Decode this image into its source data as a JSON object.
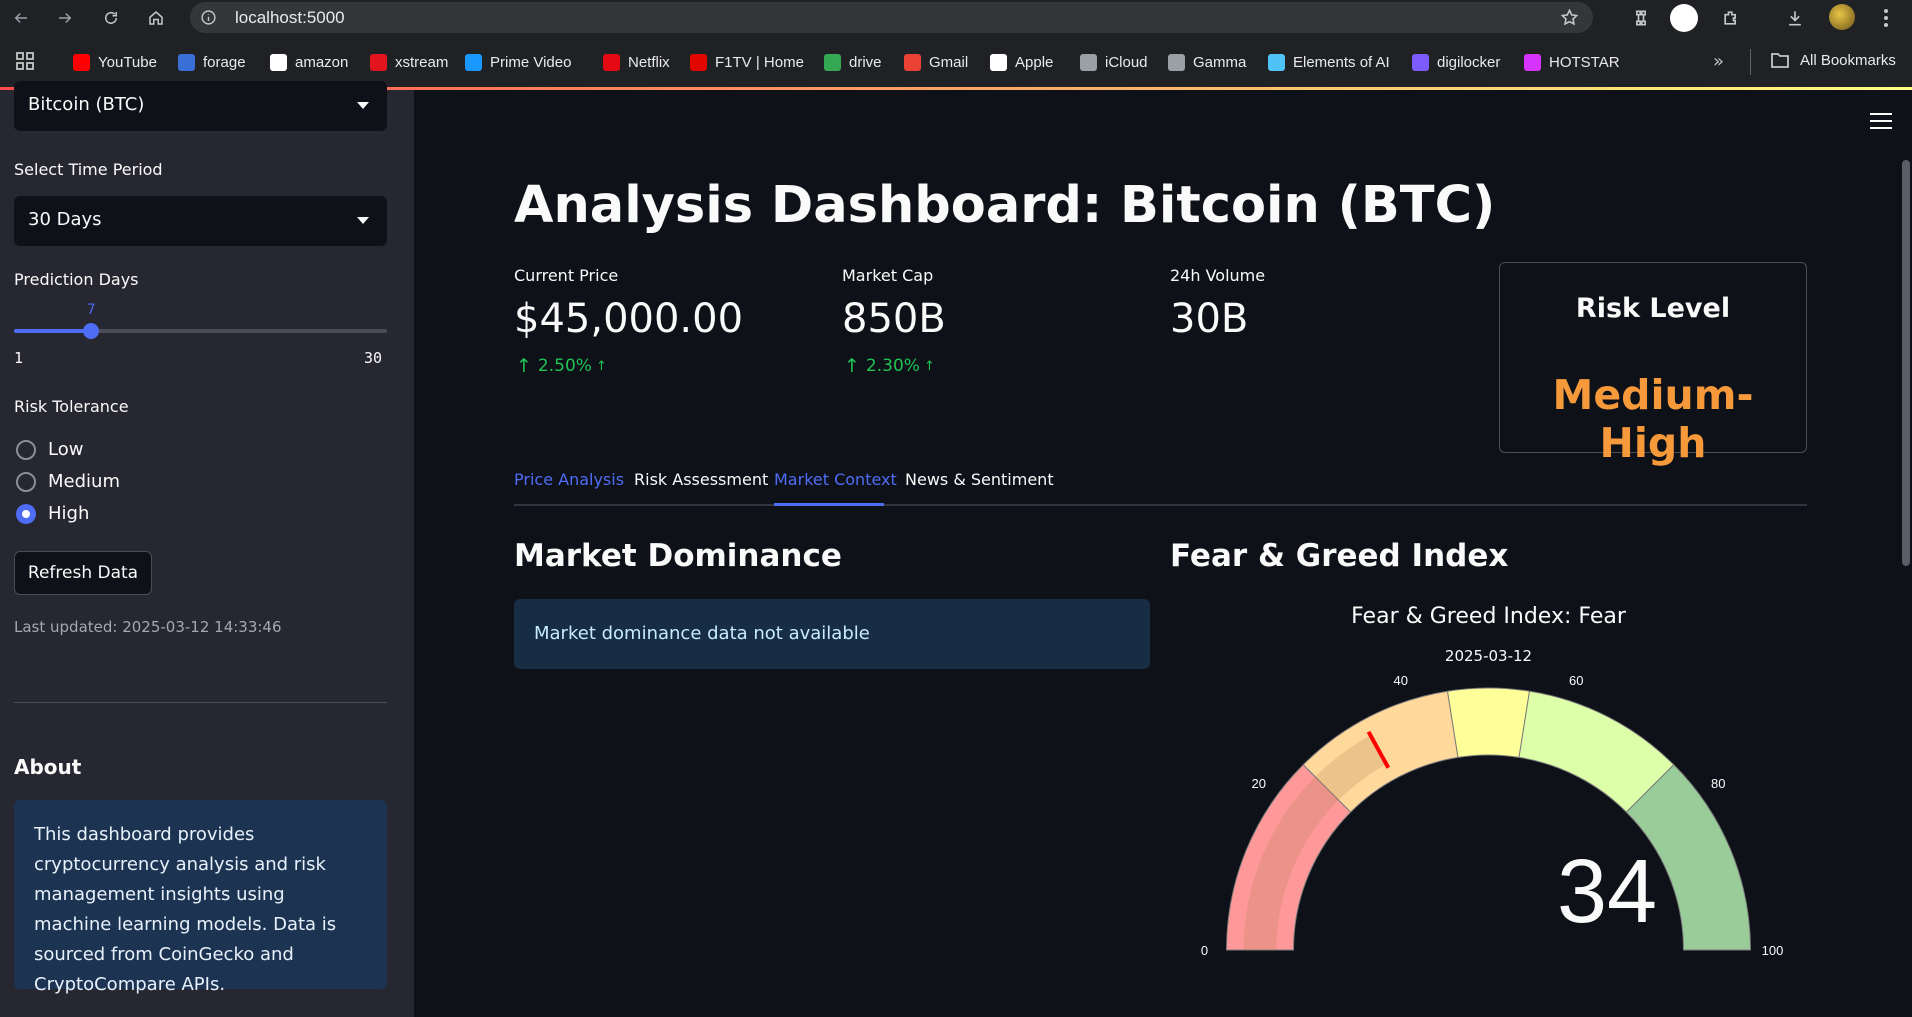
{
  "browser": {
    "url": "localhost:5000",
    "bookmarks": [
      {
        "label": "YouTube",
        "color": "#ff0000"
      },
      {
        "label": "forage",
        "color": "#3a6fd8"
      },
      {
        "label": "amazon",
        "color": "#ffffff"
      },
      {
        "label": "xstream",
        "color": "#e2141e"
      },
      {
        "label": "Prime Video",
        "color": "#1a98ff"
      },
      {
        "label": "Netflix",
        "color": "#e50914"
      },
      {
        "label": "F1TV | Home",
        "color": "#e10600"
      },
      {
        "label": "drive",
        "color": "#34a853"
      },
      {
        "label": "Gmail",
        "color": "#ea4335"
      },
      {
        "label": "Apple",
        "color": "#ffffff"
      },
      {
        "label": "iCloud",
        "color": "#9aa0a6"
      },
      {
        "label": "Gamma",
        "color": "#9aa0a6"
      },
      {
        "label": "Elements of AI",
        "color": "#4fc3f7"
      },
      {
        "label": "digilocker",
        "color": "#7c5cff"
      },
      {
        "label": "HOTSTAR",
        "color": "#d633ff"
      }
    ],
    "more_label": "»",
    "all_bookmarks": "All Bookmarks"
  },
  "sidebar": {
    "crypto_select": "Bitcoin (BTC)",
    "time_period_label": "Select Time Period",
    "time_period_value": "30 Days",
    "prediction_label": "Prediction Days",
    "prediction": {
      "value": 7,
      "min": 1,
      "max": 30
    },
    "prediction_value_text": "7",
    "prediction_min_text": "1",
    "prediction_max_text": "30",
    "risk_label": "Risk Tolerance",
    "risk_options": [
      "Low",
      "Medium",
      "High"
    ],
    "risk_selected": "High",
    "refresh_label": "Refresh Data",
    "last_updated": "Last updated: 2025-03-12 14:33:46",
    "about_title": "About",
    "about_text": "This dashboard provides cryptocurrency analysis and risk management insights using machine learning models. Data is sourced from CoinGecko and CryptoCompare APIs."
  },
  "main": {
    "title": "Analysis Dashboard: Bitcoin (BTC)",
    "metrics": [
      {
        "label": "Current Price",
        "value": "$45,000.00",
        "delta": "2.50%"
      },
      {
        "label": "Market Cap",
        "value": "850B",
        "delta": "2.30%"
      },
      {
        "label": "24h Volume",
        "value": "30B",
        "delta": ""
      }
    ],
    "risk": {
      "title": "Risk Level",
      "value": "Medium-High",
      "color": "#f5993b"
    },
    "tabs": [
      "Price Analysis",
      "Risk Assessment",
      "Market Context",
      "News & Sentiment"
    ],
    "active_tab": "Market Context",
    "market_dominance_title": "Market Dominance",
    "market_dominance_msg": "Market dominance data not available",
    "fear_greed_title": "Fear & Greed Index"
  },
  "chart_data": {
    "type": "gauge",
    "title": "Fear & Greed Index: Fear",
    "subtitle": "2025-03-12",
    "value": 34,
    "value_text": "34",
    "range": [
      0,
      100
    ],
    "ticks": [
      0,
      20,
      40,
      60,
      80,
      100
    ],
    "tick_labels": [
      "0",
      "20",
      "40",
      "60",
      "80",
      "100"
    ],
    "bands": [
      {
        "from": 0,
        "to": 25,
        "color": "#ff9999"
      },
      {
        "from": 25,
        "to": 45,
        "color": "#ffd89b"
      },
      {
        "from": 45,
        "to": 55,
        "color": "#ffff99"
      },
      {
        "from": 55,
        "to": 75,
        "color": "#ddffaa"
      },
      {
        "from": 75,
        "to": 100,
        "color": "#99cc99"
      }
    ],
    "threshold": 34,
    "threshold_color": "#ff0000"
  },
  "colors": {
    "accent": "#4f6cf5",
    "positive": "#21c354"
  }
}
